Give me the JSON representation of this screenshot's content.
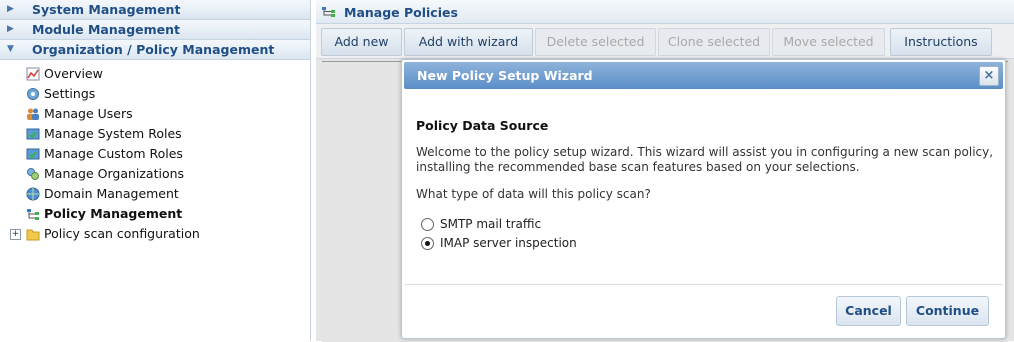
{
  "sidebar": {
    "sections": [
      {
        "label": "System Management",
        "state": "collapsed"
      },
      {
        "label": "Module Management",
        "state": "collapsed"
      },
      {
        "label": "Organization / Policy Management",
        "state": "expanded"
      }
    ],
    "items": [
      {
        "label": "Overview",
        "icon": "chart-icon"
      },
      {
        "label": "Settings",
        "icon": "settings-icon"
      },
      {
        "label": "Manage Users",
        "icon": "users-icon"
      },
      {
        "label": "Manage System Roles",
        "icon": "system-roles-icon"
      },
      {
        "label": "Manage Custom Roles",
        "icon": "custom-roles-icon"
      },
      {
        "label": "Manage Organizations",
        "icon": "organizations-icon"
      },
      {
        "label": "Domain Management",
        "icon": "globe-icon"
      },
      {
        "label": "Policy Management",
        "icon": "policy-tree-icon",
        "active": true
      },
      {
        "label": "Policy scan configuration",
        "icon": "folder-icon",
        "expandable": true
      }
    ]
  },
  "main": {
    "title": "Manage Policies",
    "toolbar": [
      {
        "label": "Add new",
        "enabled": true
      },
      {
        "label": "Add with wizard",
        "enabled": true
      },
      {
        "label": "Delete selected",
        "enabled": false
      },
      {
        "label": "Clone selected",
        "enabled": false
      },
      {
        "label": "Move selected",
        "enabled": false
      },
      {
        "label": "Instructions",
        "enabled": true
      }
    ]
  },
  "dialog": {
    "title": "New Policy Setup Wizard",
    "close_symbol": "×",
    "section_title": "Policy Data Source",
    "description": "Welcome to the policy setup wizard. This wizard will assist you in configuring a new scan policy, installing the recommended base scan features based on your selections.",
    "question": "What type of data will this policy scan?",
    "options": [
      {
        "label": "SMTP mail traffic",
        "selected": false
      },
      {
        "label": "IMAP server inspection",
        "selected": true
      }
    ],
    "cancel_label": "Cancel",
    "continue_label": "Continue"
  },
  "colors": {
    "accent": "#1f4f86",
    "dialog_header": "#6b9bd0",
    "sidebar_header_bg": "#dbe6f1"
  }
}
